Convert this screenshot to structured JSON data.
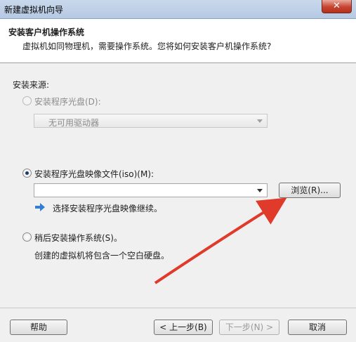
{
  "window": {
    "title": "新建虚拟机向导",
    "close_label": "✕"
  },
  "header": {
    "title": "安装客户机操作系统",
    "subtitle": "虚拟机如同物理机，需要操作系统。您将如何安装客户机操作系统?"
  },
  "source": {
    "label": "安装来源:",
    "disc": {
      "label": "安装程序光盘(D):",
      "selected": false,
      "enabled": false,
      "drive_value": "无可用驱动器"
    },
    "iso": {
      "label": "安装程序光盘映像文件(iso)(M):",
      "selected": true,
      "path_value": "",
      "browse_label": "浏览(R)...",
      "hint": "选择安装程序光盘映像继续。"
    },
    "later": {
      "label": "稍后安装操作系统(S)。",
      "selected": false,
      "description": "创建的虚拟机将包含一个空白硬盘。"
    }
  },
  "footer": {
    "help_label": "帮助",
    "back_label": "< 上一步(B)",
    "next_label": "下一步(N) >",
    "cancel_label": "取消"
  },
  "colors": {
    "annotation_arrow": "#e03a2a",
    "hint_arrow": "#2f7fd6"
  },
  "icons": [
    "close-icon",
    "dropdown-arrow-icon",
    "blue-arrow-icon"
  ]
}
